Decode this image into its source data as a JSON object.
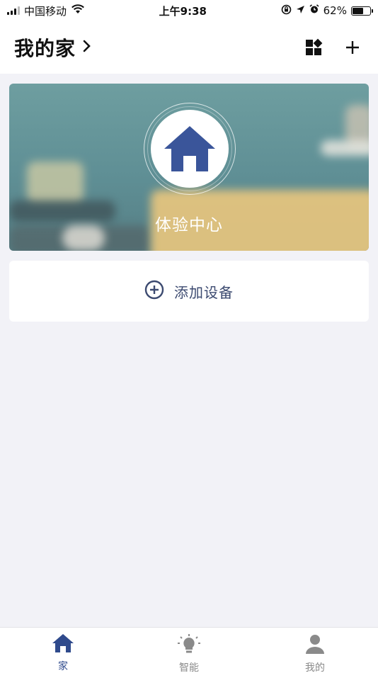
{
  "status_bar": {
    "carrier": "中国移动",
    "time": "上午9:38",
    "battery_percent": "62%",
    "battery_level": 0.62
  },
  "header": {
    "title": "我的家",
    "actions": [
      "grid-icon",
      "plus-icon"
    ]
  },
  "banner": {
    "label": "体验中心",
    "icon": "house-icon"
  },
  "add_device": {
    "label": "添加设备",
    "icon": "plus-circle-icon"
  },
  "tabbar": {
    "tabs": [
      {
        "label": "家",
        "icon": "house-icon",
        "active": true
      },
      {
        "label": "智能",
        "icon": "lightbulb-icon",
        "active": false
      },
      {
        "label": "我的",
        "icon": "person-icon",
        "active": false
      }
    ]
  },
  "colors": {
    "accent": "#2f4a8c",
    "icon_blue": "#3a559a",
    "background": "#f2f2f7",
    "tab_inactive": "#8a8a8a"
  }
}
